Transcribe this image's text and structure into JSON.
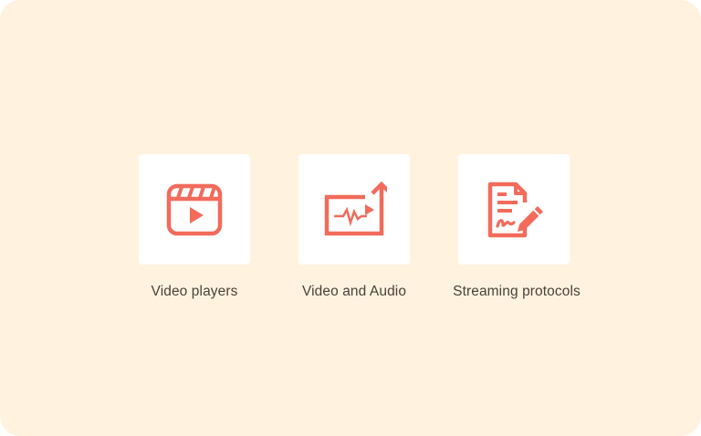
{
  "colors": {
    "background": "#fff3e0",
    "tile": "#ffffff",
    "accent": "#f26b5b",
    "text": "#4a3f39"
  },
  "features": [
    {
      "label": "Video players",
      "icon": "video-player-icon"
    },
    {
      "label": "Video and Audio",
      "icon": "video-audio-upload-icon"
    },
    {
      "label": "Streaming protocols",
      "icon": "document-sign-icon"
    }
  ]
}
